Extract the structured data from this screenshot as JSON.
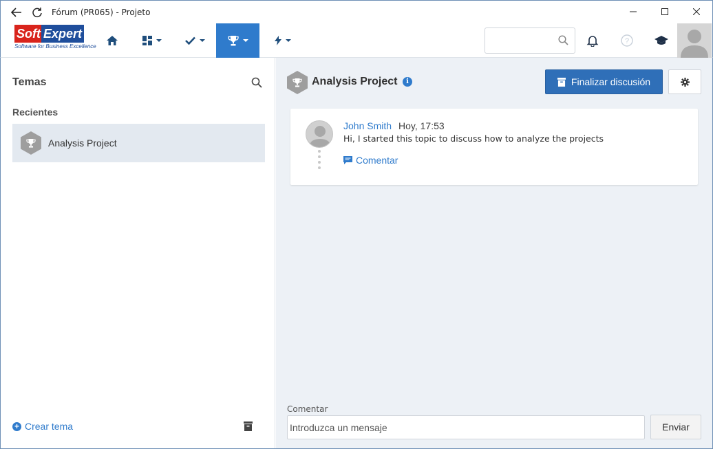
{
  "window": {
    "title": "Fórum (PR065) - Projeto"
  },
  "logo": {
    "part1": "Soft",
    "part2": "Expert",
    "tagline": "Software for Business Excellence"
  },
  "topnav": {
    "items": [
      {
        "name": "home",
        "icon": "home-icon"
      },
      {
        "name": "dashboard",
        "icon": "grid-icon",
        "dropdown": true
      },
      {
        "name": "tasks",
        "icon": "check-icon",
        "dropdown": true
      },
      {
        "name": "forum",
        "icon": "trophy-icon",
        "dropdown": true,
        "active": true
      },
      {
        "name": "actions",
        "icon": "bolt-icon",
        "dropdown": true
      }
    ],
    "search_placeholder": "",
    "icons": [
      "search-icon",
      "bell-icon",
      "help-icon",
      "graduation-cap-icon",
      "user-avatar"
    ]
  },
  "left_panel": {
    "title": "Temas",
    "recent_label": "Recientes",
    "topics": [
      {
        "name": "Analysis Project",
        "icon": "trophy-icon",
        "selected": true
      }
    ],
    "create_label": "Crear tema"
  },
  "right_panel": {
    "topic_title": "Analysis Project",
    "finalize_label": "Finalizar discusión",
    "messages": [
      {
        "author": "John Smith",
        "time": "Hoy, 17:53",
        "text": "Hi, I started this topic to discuss how to analyze the projects",
        "comment_label": "Comentar"
      }
    ],
    "compose": {
      "label": "Comentar",
      "placeholder": "Introduzca un mensaje",
      "send_label": "Enviar"
    }
  },
  "colors": {
    "accent": "#2f7bcc",
    "primary_button": "#2f6fb8",
    "nav_active": "#2f7bcc",
    "panel_bg": "#edf1f6",
    "selected_row": "#e3e9f0"
  }
}
